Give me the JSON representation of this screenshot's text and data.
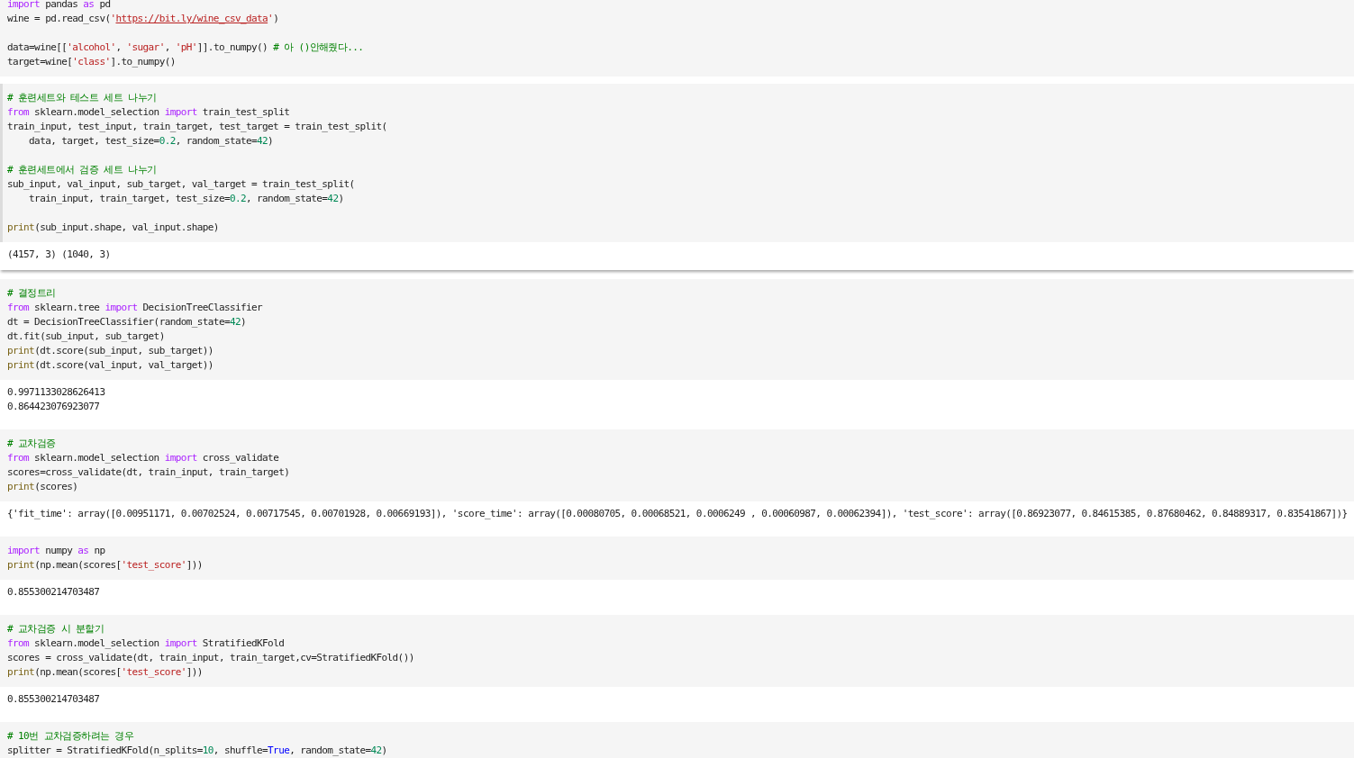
{
  "cells": [
    {
      "selected": false,
      "code": [
        {
          "kind": "code",
          "tokens": [
            {
              "t": "import",
              "kind": "keyword"
            },
            {
              "t": " pandas "
            },
            {
              "t": "as",
              "kind": "keyword"
            },
            {
              "t": " pd"
            }
          ]
        },
        {
          "kind": "code",
          "tokens": [
            {
              "t": "wine = pd.read_csv("
            },
            {
              "t": "'",
              "kind": "string"
            },
            {
              "t": "https://bit.ly/wine_csv_data",
              "kind": "link"
            },
            {
              "t": "'",
              "kind": "string"
            },
            {
              "t": ")"
            }
          ]
        },
        {
          "kind": "blank"
        },
        {
          "kind": "code",
          "tokens": [
            {
              "t": "data=wine[["
            },
            {
              "t": "'alcohol'",
              "kind": "string"
            },
            {
              "t": ", "
            },
            {
              "t": "'sugar'",
              "kind": "string"
            },
            {
              "t": ", "
            },
            {
              "t": "'pH'",
              "kind": "string"
            },
            {
              "t": "]].to_numpy() "
            },
            {
              "t": "# 아 ()안해줬다...",
              "kind": "comment"
            }
          ]
        },
        {
          "kind": "code",
          "tokens": [
            {
              "t": "target=wine["
            },
            {
              "t": "'class'",
              "kind": "string"
            },
            {
              "t": "].to_numpy()"
            }
          ]
        }
      ]
    },
    {
      "selected": true,
      "code": [
        {
          "kind": "code",
          "tokens": [
            {
              "t": "# 훈련세트와 테스트 세트 나누기",
              "kind": "comment"
            }
          ]
        },
        {
          "kind": "code",
          "tokens": [
            {
              "t": "from",
              "kind": "keyword"
            },
            {
              "t": " sklearn.model_selection "
            },
            {
              "t": "import",
              "kind": "keyword"
            },
            {
              "t": " train_test_split"
            }
          ]
        },
        {
          "kind": "code",
          "tokens": [
            {
              "t": "train_input, test_input, train_target, test_target = train_test_split("
            }
          ]
        },
        {
          "kind": "code",
          "tokens": [
            {
              "t": "    data, target, test_size="
            },
            {
              "t": "0.2",
              "kind": "number"
            },
            {
              "t": ", random_state="
            },
            {
              "t": "42",
              "kind": "number"
            },
            {
              "t": ")"
            }
          ]
        },
        {
          "kind": "blank"
        },
        {
          "kind": "code",
          "tokens": [
            {
              "t": "# 훈련세트에서 검증 세트 나누기",
              "kind": "comment"
            }
          ]
        },
        {
          "kind": "code",
          "tokens": [
            {
              "t": "sub_input, val_input, sub_target, val_target = train_test_split("
            }
          ]
        },
        {
          "kind": "code",
          "tokens": [
            {
              "t": "    train_input, train_target, test_size="
            },
            {
              "t": "0.2",
              "kind": "number"
            },
            {
              "t": ", random_state="
            },
            {
              "t": "42",
              "kind": "number"
            },
            {
              "t": ")"
            }
          ]
        },
        {
          "kind": "blank"
        },
        {
          "kind": "code",
          "tokens": [
            {
              "t": "print",
              "kind": "builtin"
            },
            {
              "t": "(sub_input.shape, val_input.shape)"
            }
          ]
        }
      ],
      "output": [
        "(4157, 3) (1040, 3)"
      ]
    },
    {
      "selected": false,
      "code": [
        {
          "kind": "code",
          "tokens": [
            {
              "t": "# 결정트리",
              "kind": "comment"
            }
          ]
        },
        {
          "kind": "code",
          "tokens": [
            {
              "t": "from",
              "kind": "keyword"
            },
            {
              "t": " sklearn.tree "
            },
            {
              "t": "import",
              "kind": "keyword"
            },
            {
              "t": " DecisionTreeClassifier"
            }
          ]
        },
        {
          "kind": "code",
          "tokens": [
            {
              "t": "dt = DecisionTreeClassifier(random_state="
            },
            {
              "t": "42",
              "kind": "number"
            },
            {
              "t": ")"
            }
          ]
        },
        {
          "kind": "code",
          "tokens": [
            {
              "t": "dt.fit(sub_input, sub_target)"
            }
          ]
        },
        {
          "kind": "code",
          "tokens": [
            {
              "t": "print",
              "kind": "builtin"
            },
            {
              "t": "(dt.score(sub_input, sub_target))"
            }
          ]
        },
        {
          "kind": "code",
          "tokens": [
            {
              "t": "print",
              "kind": "builtin"
            },
            {
              "t": "(dt.score(val_input, val_target))"
            }
          ]
        }
      ],
      "output": [
        "0.9971133028626413",
        "0.864423076923077"
      ]
    },
    {
      "selected": false,
      "code": [
        {
          "kind": "code",
          "tokens": [
            {
              "t": "# 교차검증",
              "kind": "comment"
            }
          ]
        },
        {
          "kind": "code",
          "tokens": [
            {
              "t": "from",
              "kind": "keyword"
            },
            {
              "t": " sklearn.model_selection "
            },
            {
              "t": "import",
              "kind": "keyword"
            },
            {
              "t": " cross_validate"
            }
          ]
        },
        {
          "kind": "code",
          "tokens": [
            {
              "t": "scores=cross_validate(dt, train_input, train_target)"
            }
          ]
        },
        {
          "kind": "code",
          "tokens": [
            {
              "t": "print",
              "kind": "builtin"
            },
            {
              "t": "(scores)"
            }
          ]
        }
      ],
      "output": [
        "{'fit_time': array([0.00951171, 0.00702524, 0.00717545, 0.00701928, 0.00669193]), 'score_time': array([0.00080705, 0.00068521, 0.0006249 , 0.00060987, 0.00062394]), 'test_score': array([0.86923077, 0.84615385, 0.87680462, 0.84889317, 0.83541867])}"
      ]
    },
    {
      "selected": false,
      "code": [
        {
          "kind": "code",
          "tokens": [
            {
              "t": "import",
              "kind": "keyword"
            },
            {
              "t": " numpy "
            },
            {
              "t": "as",
              "kind": "keyword"
            },
            {
              "t": " np"
            }
          ]
        },
        {
          "kind": "code",
          "tokens": [
            {
              "t": "print",
              "kind": "builtin"
            },
            {
              "t": "(np.mean(scores["
            },
            {
              "t": "'test_score'",
              "kind": "string"
            },
            {
              "t": "]))"
            }
          ]
        }
      ],
      "output": [
        "0.855300214703487"
      ]
    },
    {
      "selected": false,
      "code": [
        {
          "kind": "code",
          "tokens": [
            {
              "t": "# 교차검증 시 분할기",
              "kind": "comment"
            }
          ]
        },
        {
          "kind": "code",
          "tokens": [
            {
              "t": "from",
              "kind": "keyword"
            },
            {
              "t": " sklearn.model_selection "
            },
            {
              "t": "import",
              "kind": "keyword"
            },
            {
              "t": " StratifiedKFold"
            }
          ]
        },
        {
          "kind": "code",
          "tokens": [
            {
              "t": "scores = cross_validate(dt, train_input, train_target,cv=StratifiedKFold())"
            }
          ]
        },
        {
          "kind": "code",
          "tokens": [
            {
              "t": "print",
              "kind": "builtin"
            },
            {
              "t": "(np.mean(scores["
            },
            {
              "t": "'test_score'",
              "kind": "string"
            },
            {
              "t": "]))"
            }
          ]
        }
      ],
      "output": [
        "0.855300214703487"
      ]
    },
    {
      "selected": false,
      "code": [
        {
          "kind": "code",
          "tokens": [
            {
              "t": "# 10번 교차검증하려는 경우",
              "kind": "comment"
            }
          ]
        },
        {
          "kind": "code",
          "tokens": [
            {
              "t": "splitter = StratifiedKFold(n_splits="
            },
            {
              "t": "10",
              "kind": "number"
            },
            {
              "t": ", shuffle="
            },
            {
              "t": "True",
              "kind": "constant"
            },
            {
              "t": ", random_state="
            },
            {
              "t": "42",
              "kind": "number"
            },
            {
              "t": ")"
            }
          ]
        }
      ]
    }
  ]
}
